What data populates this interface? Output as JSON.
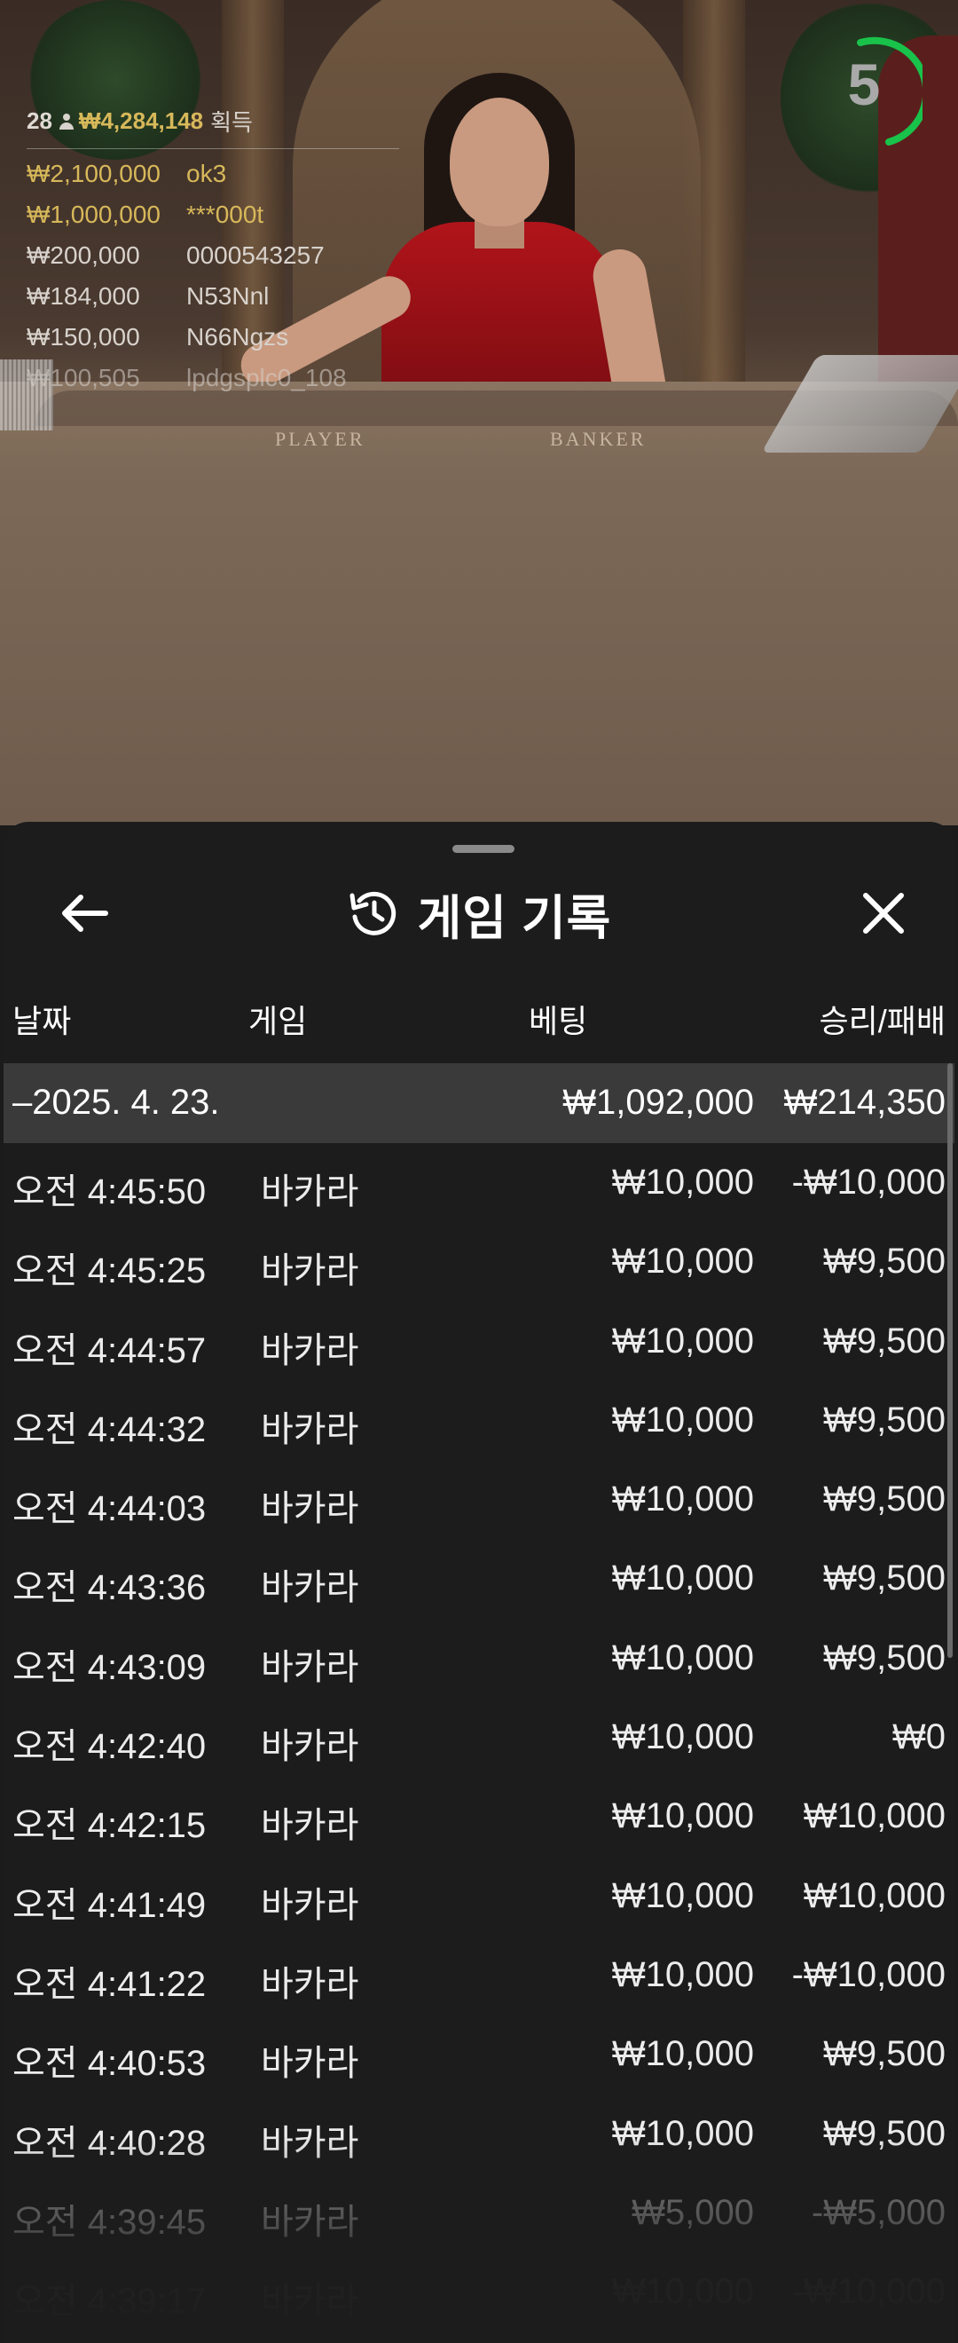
{
  "video": {
    "table_labels": {
      "player": "PLAYER",
      "banker": "BANKER"
    },
    "countdown": "5"
  },
  "winners": {
    "player_count": "28",
    "total": "₩4,284,148",
    "total_suffix": "획득",
    "list": [
      {
        "amount": "₩2,100,000",
        "user": "ok3"
      },
      {
        "amount": "₩1,000,000",
        "user": "***000t"
      },
      {
        "amount": "₩200,000",
        "user": "0000543257"
      },
      {
        "amount": "₩184,000",
        "user": "N53Nnl"
      },
      {
        "amount": "₩150,000",
        "user": "N66Ngzs"
      },
      {
        "amount": "₩100,505",
        "user": "lpdgsplc0_108"
      }
    ]
  },
  "panel": {
    "title": "게임 기록",
    "columns": {
      "date": "날짜",
      "game": "게임",
      "bet": "베팅",
      "result": "승리/패배"
    },
    "date_group": {
      "label": "–2025. 4. 23.",
      "bet_total": "₩1,092,000",
      "result_total": "₩214,350"
    },
    "rows": [
      {
        "time": "오전 4:45:50",
        "game": "바카라",
        "bet": "₩10,000",
        "result": "-₩10,000"
      },
      {
        "time": "오전 4:45:25",
        "game": "바카라",
        "bet": "₩10,000",
        "result": "₩9,500"
      },
      {
        "time": "오전 4:44:57",
        "game": "바카라",
        "bet": "₩10,000",
        "result": "₩9,500"
      },
      {
        "time": "오전 4:44:32",
        "game": "바카라",
        "bet": "₩10,000",
        "result": "₩9,500"
      },
      {
        "time": "오전 4:44:03",
        "game": "바카라",
        "bet": "₩10,000",
        "result": "₩9,500"
      },
      {
        "time": "오전 4:43:36",
        "game": "바카라",
        "bet": "₩10,000",
        "result": "₩9,500"
      },
      {
        "time": "오전 4:43:09",
        "game": "바카라",
        "bet": "₩10,000",
        "result": "₩9,500"
      },
      {
        "time": "오전 4:42:40",
        "game": "바카라",
        "bet": "₩10,000",
        "result": "₩0"
      },
      {
        "time": "오전 4:42:15",
        "game": "바카라",
        "bet": "₩10,000",
        "result": "₩10,000"
      },
      {
        "time": "오전 4:41:49",
        "game": "바카라",
        "bet": "₩10,000",
        "result": "₩10,000"
      },
      {
        "time": "오전 4:41:22",
        "game": "바카라",
        "bet": "₩10,000",
        "result": "-₩10,000"
      },
      {
        "time": "오전 4:40:53",
        "game": "바카라",
        "bet": "₩10,000",
        "result": "₩9,500"
      },
      {
        "time": "오전 4:40:28",
        "game": "바카라",
        "bet": "₩10,000",
        "result": "₩9,500"
      },
      {
        "time": "오전 4:39:45",
        "game": "바카라",
        "bet": "₩5,000",
        "result": "-₩5,000"
      },
      {
        "time": "오전 4:39:17",
        "game": "바카라",
        "bet": "₩10,000",
        "result": "-₩10,000"
      }
    ]
  },
  "colors": {
    "gold": "#d7b85a",
    "timer_green": "#19c24a",
    "panel_bg": "#1c1c1c",
    "date_row_bg": "#3a3a3a"
  }
}
